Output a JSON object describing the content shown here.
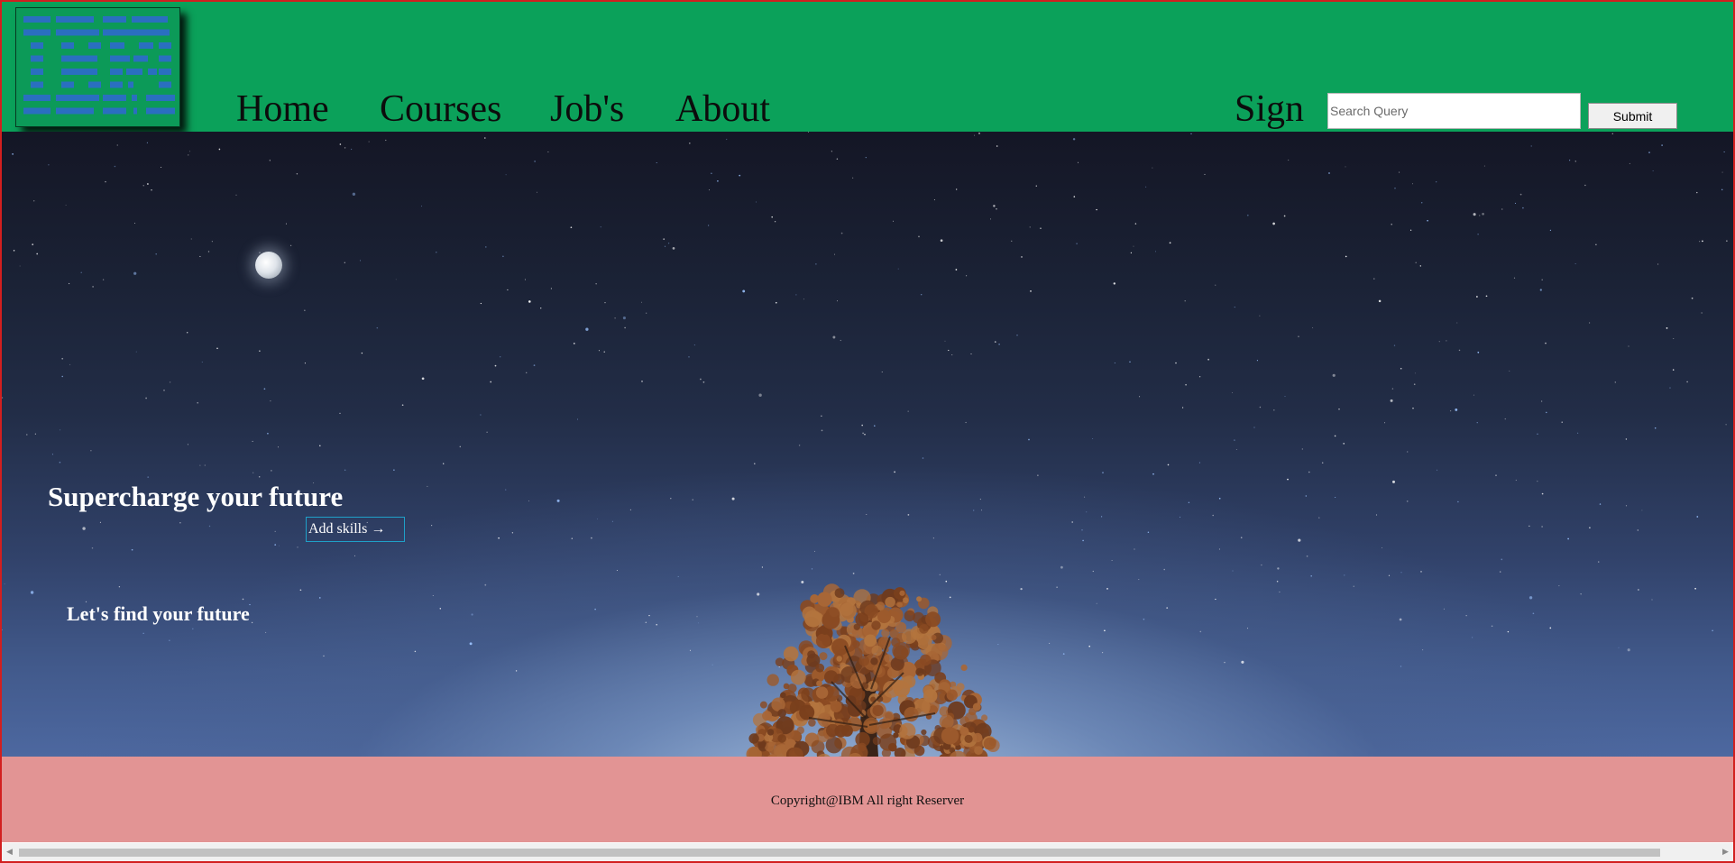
{
  "brand": {
    "logo_text": "IBM",
    "logo_icon": "ibm-striped-logo-icon",
    "logo_color": "#2a6fc0"
  },
  "colors": {
    "header_bg": "#0ba15a",
    "footer_bg": "#e29494",
    "frame_border": "#d21f1f",
    "hero_text": "#ffffff",
    "button_border": "#1fa0c8"
  },
  "nav": {
    "items": [
      {
        "label": "Home"
      },
      {
        "label": "Courses"
      },
      {
        "label": "Job's"
      },
      {
        "label": "About"
      }
    ],
    "sign_label": "Sign"
  },
  "search": {
    "value": "",
    "placeholder": "Search Query",
    "submit_label": "Submit"
  },
  "hero": {
    "title": "Supercharge your future",
    "cta_label": "Add skills →",
    "subtitle": "Let's find your future"
  },
  "footer": {
    "copyright": "Copyright@IBM All right Reserver"
  },
  "scrollbar": {
    "left_arrow_icon": "scroll-left-arrow-icon",
    "right_arrow_icon": "scroll-right-arrow-icon",
    "position": 0
  }
}
